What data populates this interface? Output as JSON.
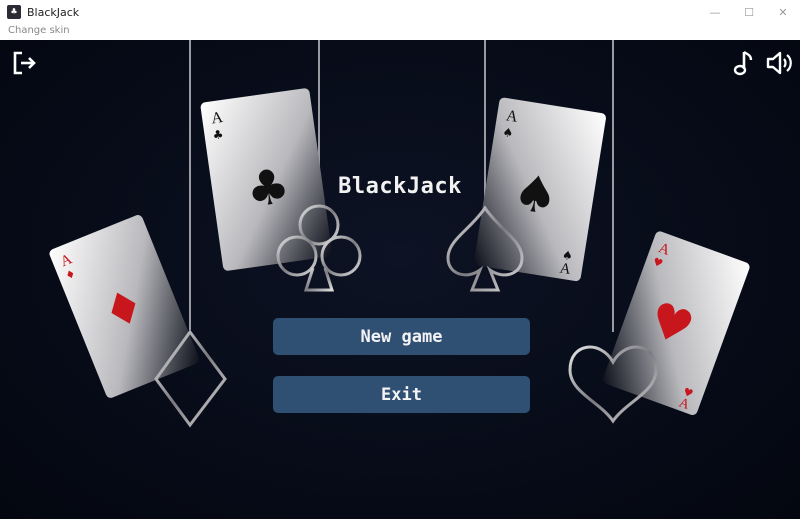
{
  "window": {
    "title": "BlackJack",
    "controls": {
      "minimize": "—",
      "maximize": "☐",
      "close": "✕"
    }
  },
  "menu": {
    "change_skin": "Change skin"
  },
  "game": {
    "title": "BlackJack",
    "buttons": {
      "new_game": "New game",
      "exit": "Exit"
    },
    "icons": {
      "exit": "exit-door-icon",
      "music": "music-note-icon",
      "sound": "speaker-volume-icon"
    }
  },
  "cards": [
    {
      "rank": "A",
      "suit": "clubs"
    },
    {
      "rank": "A",
      "suit": "spades"
    },
    {
      "rank": "A",
      "suit": "diamonds"
    },
    {
      "rank": "A",
      "suit": "hearts"
    }
  ],
  "colors": {
    "background": "#060a16",
    "button": "#2f4f73",
    "red_suit": "#c8161d"
  }
}
